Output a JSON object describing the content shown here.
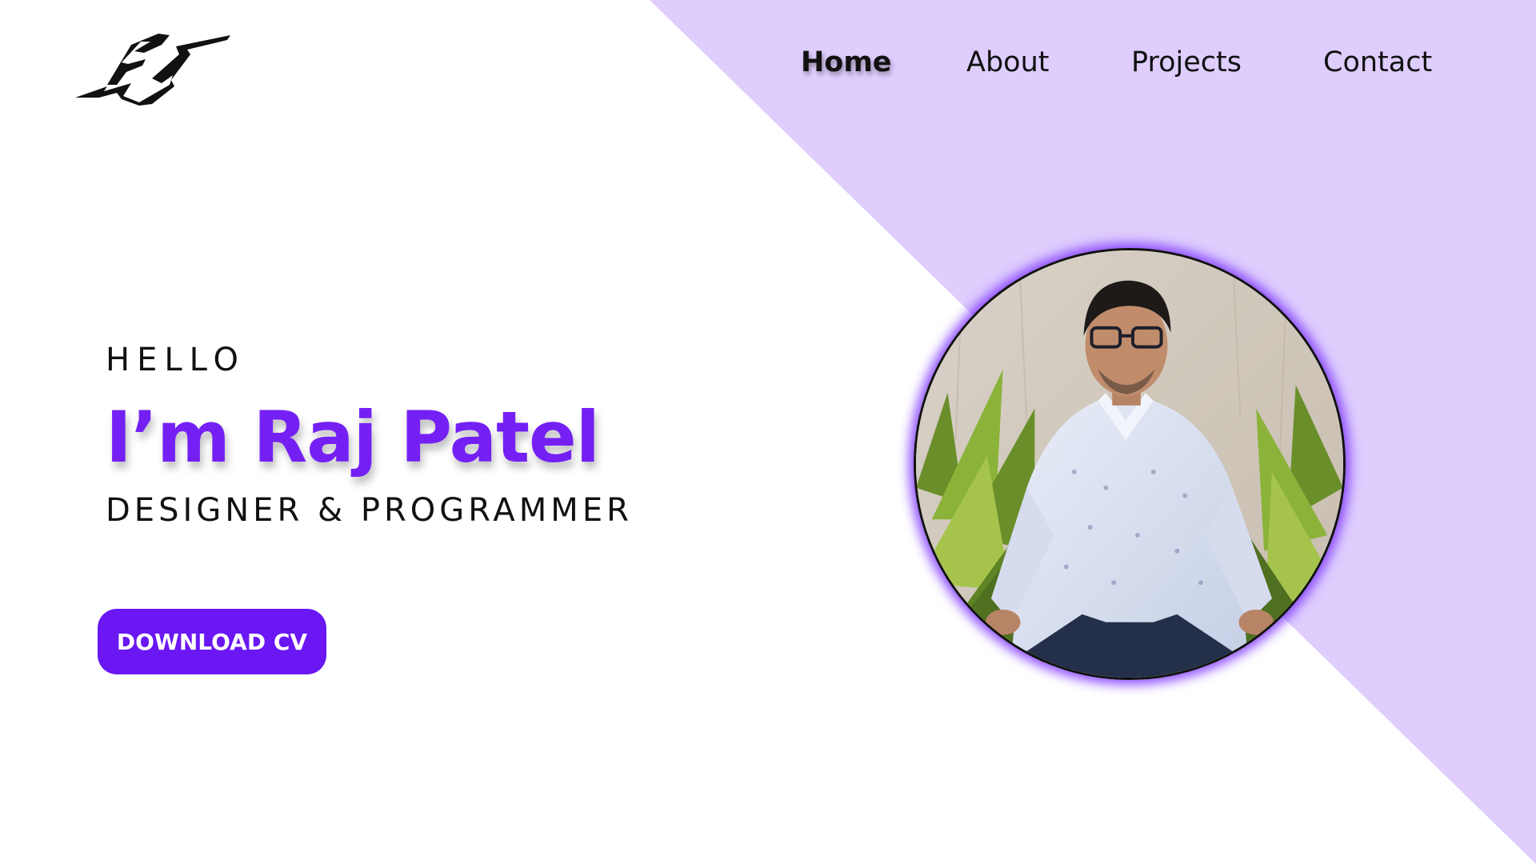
{
  "nav": {
    "items": [
      {
        "label": "Home",
        "active": true
      },
      {
        "label": "About",
        "active": false
      },
      {
        "label": "Projects",
        "active": false
      },
      {
        "label": "Contact",
        "active": false
      }
    ]
  },
  "logo": {
    "text": "RJ",
    "icon": "signature-logo"
  },
  "hero": {
    "greeting": "HELLO",
    "name": "I’m Raj Patel",
    "role": "DESIGNER & PROGRAMMER",
    "cta_label": "DOWNLOAD CV"
  },
  "profile_photo": {
    "icon": "profile-photo"
  },
  "colors": {
    "accent": "#7420f5",
    "button": "#6a17f4",
    "diagonal_panel": "#decdfd",
    "text": "#111111",
    "background": "#ffffff"
  }
}
